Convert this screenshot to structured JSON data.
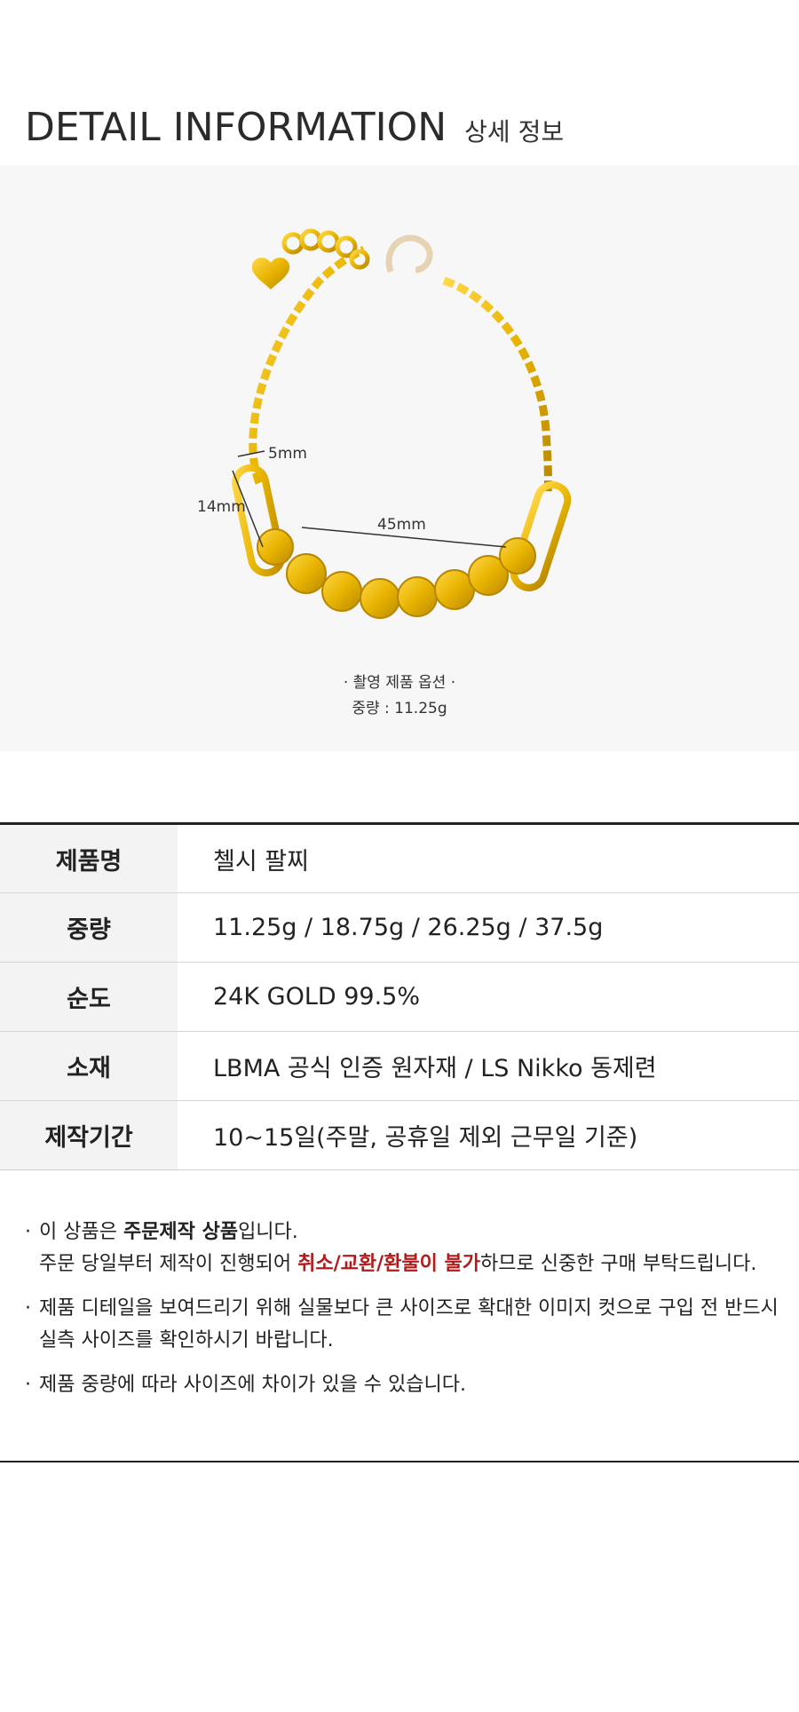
{
  "header": {
    "title": "DETAIL INFORMATION",
    "subtitle": "상세 정보"
  },
  "photo": {
    "alt": "bracelet-photo",
    "dim_width_link": "5mm",
    "dim_length_link": "14mm",
    "dim_span": "45mm",
    "caption_line1": "· 촬영 제품 옵션 ·",
    "caption_line2": "중량 : 11.25g",
    "colors": {
      "gold": "#e8b400",
      "gold_dark": "#b88600",
      "clasp": "#e6d3b3"
    }
  },
  "spec_table": {
    "rows": [
      {
        "label": "제품명",
        "value": "첼시 팔찌"
      },
      {
        "label": "중량",
        "value": "11.25g / 18.75g / 26.25g / 37.5g"
      },
      {
        "label": "순도",
        "value": "24K GOLD 99.5%"
      },
      {
        "label": "소재",
        "value": "LBMA 공식 인증 원자재 / LS Nikko 동제련"
      },
      {
        "label": "제작기간",
        "value": "10~15일(주말, 공휴일 제외 근무일 기준)"
      }
    ]
  },
  "notes": {
    "n1_prefix": "이 상품은 ",
    "n1_bold": "주문제작 상품",
    "n1_suffix": "입니다.",
    "n1_line2_prefix": "주문 당일부터 제작이 진행되어 ",
    "n1_line2_red": "취소/교환/환불이 불가",
    "n1_line2_suffix": "하므로 신중한 구매 부탁드립니다.",
    "n2_line1": "제품 디테일을 보여드리기 위해 실물보다 큰 사이즈로 확대한 이미지 컷으로 구입 전 반드시",
    "n2_line2": "실측 사이즈를 확인하시기 바랍니다.",
    "n3": " 제품 중량에 따라 사이즈에 차이가 있을 수 있습니다.",
    "bullet": "·"
  }
}
